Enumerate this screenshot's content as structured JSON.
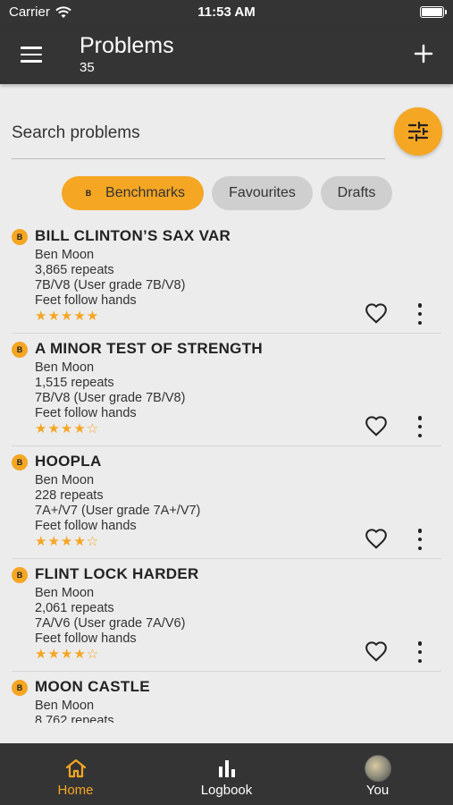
{
  "status_bar": {
    "carrier": "Carrier",
    "time": "11:53 AM"
  },
  "app_bar": {
    "title": "Problems",
    "subtitle": "35"
  },
  "search": {
    "placeholder": "Search problems",
    "value": ""
  },
  "chips": {
    "benchmarks": "Benchmarks",
    "favourites": "Favourites",
    "drafts": "Drafts",
    "badge": "B"
  },
  "accent_color": "#f5a623",
  "problems": [
    {
      "name": "BILL CLINTON’S SAX VAR",
      "setter": "Ben Moon",
      "repeats": "3,865 repeats",
      "grade": "7B/V8 (User grade 7B/V8)",
      "rule": "Feet follow hands",
      "stars": "★★★★★",
      "badge": "B"
    },
    {
      "name": "A MINOR TEST OF STRENGTH",
      "setter": "Ben Moon",
      "repeats": "1,515 repeats",
      "grade": "7B/V8 (User grade 7B/V8)",
      "rule": "Feet follow hands",
      "stars": "★★★★☆",
      "badge": "B"
    },
    {
      "name": "HOOPLA",
      "setter": "Ben Moon",
      "repeats": "228 repeats",
      "grade": "7A+/V7 (User grade 7A+/V7)",
      "rule": "Feet follow hands",
      "stars": "★★★★☆",
      "badge": "B"
    },
    {
      "name": "FLINT LOCK HARDER",
      "setter": "Ben Moon",
      "repeats": "2,061 repeats",
      "grade": "7A/V6 (User grade 7A/V6)",
      "rule": "Feet follow hands",
      "stars": "★★★★☆",
      "badge": "B"
    },
    {
      "name": "MOON CASTLE",
      "setter": "Ben Moon",
      "repeats": "8,762 repeats",
      "badge": "B"
    }
  ],
  "bottom_nav": {
    "home": "Home",
    "logbook": "Logbook",
    "you": "You"
  },
  "icons": {
    "menu": "hamburger-menu-icon",
    "add": "plus-icon",
    "filter": "sliders-icon",
    "heart": "heart-outline-icon",
    "more": "more-vertical-icon",
    "home": "home-icon",
    "logbook": "bar-chart-icon"
  }
}
